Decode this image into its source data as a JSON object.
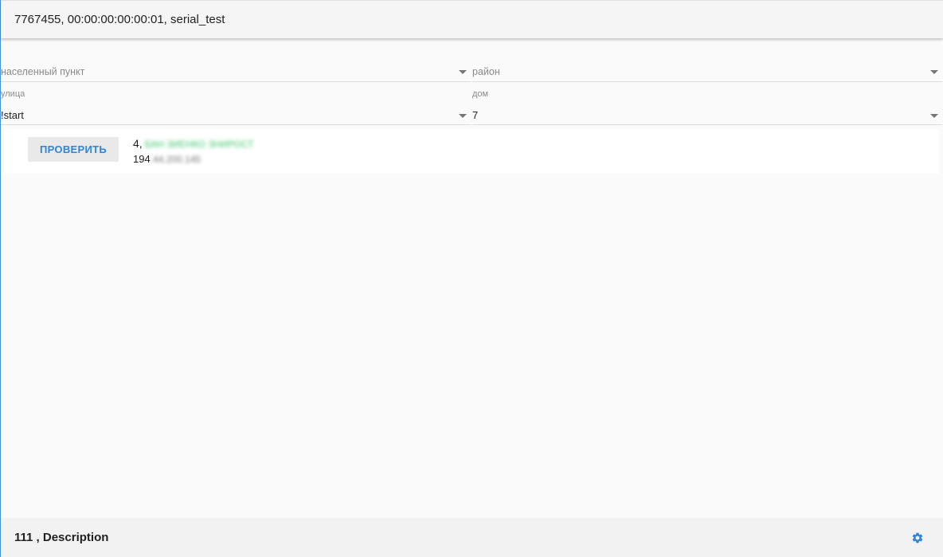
{
  "header": {
    "title": "7767455, 00:00:00:00:00:01, serial_test"
  },
  "form": {
    "locality": {
      "placeholder": "населенный пункт"
    },
    "district": {
      "placeholder": "район"
    },
    "street": {
      "label": "улица",
      "value": "!start"
    },
    "house": {
      "label": "дом",
      "value": "7"
    }
  },
  "result": {
    "check_label": "ПРОВЕРИТЬ",
    "address_prefix": "4,",
    "address_hidden": "БАН ЗИЕНКО ЗНИРОСТ",
    "ip_prefix": "194",
    "ip_hidden": ".44.200.145"
  },
  "footer": {
    "title": "111 , Description"
  },
  "icons": {
    "settings": "gear-icon",
    "dropdown": "caret-down-icon"
  },
  "colors": {
    "accent": "#2f86d8",
    "blurred_address": "#3cc66a"
  }
}
